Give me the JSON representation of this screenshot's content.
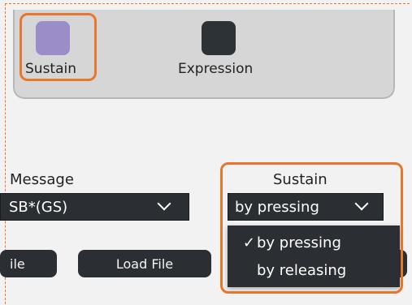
{
  "pedals": {
    "sustain_label": "Sustain",
    "expression_label": "Expression"
  },
  "message": {
    "label": "Message",
    "selected": "SB*(GS)"
  },
  "sustain_setting": {
    "label": "Sustain",
    "selected": "by pressing",
    "options": [
      "by pressing",
      "by releasing"
    ],
    "check_glyph": "✓"
  },
  "buttons": {
    "save_file_partial": "ile",
    "load_file": "Load File"
  },
  "colors": {
    "highlight": "#e8772e",
    "sustain_pedal": "#9b8ec8",
    "expression_pedal": "#2d3236",
    "control_bg": "#2b2f33"
  }
}
